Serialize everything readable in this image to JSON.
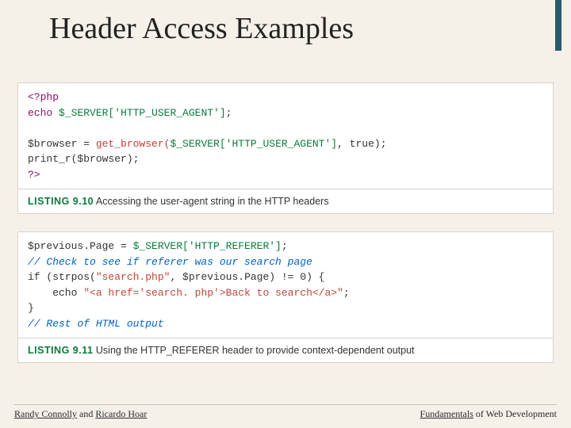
{
  "title": "Header Access Examples",
  "listing1": {
    "label": "LISTING 9.10",
    "caption": "Accessing the user-agent string in the HTTP headers",
    "code": {
      "l1a": "<?php",
      "l2a": "echo ",
      "l2b": "$_SERVER['HTTP_USER_AGENT']",
      "l2c": ";",
      "l3": "",
      "l4a": "$browser = ",
      "l4b": "get_browser(",
      "l4c": "$_SERVER['HTTP_USER_AGENT']",
      "l4d": ", true);",
      "l5": "print_r($browser);",
      "l6": "?>"
    }
  },
  "listing2": {
    "label": "LISTING 9.11",
    "caption": "Using the HTTP_REFERER header to provide context-dependent output",
    "code": {
      "l1a": "$previous.Page = ",
      "l1b": "$_SERVER['HTTP_REFERER']",
      "l1c": ";",
      "l2": "// Check to see if referer was our search page",
      "l3a": "if (strpos(",
      "l3b": "\"search.php\"",
      "l3c": ", $previous.Page) != 0) {",
      "l4a": "    echo ",
      "l4b": "\"<a href='search. php'>Back to search</a>\"",
      "l4c": ";",
      "l5": "}",
      "l6": "// Rest of HTML output"
    }
  },
  "footer": {
    "author1": "Randy Connolly",
    "and": " and ",
    "author2": "Ricardo Hoar",
    "book_pre": "Fundamentals",
    "book_post": " of Web Development"
  }
}
